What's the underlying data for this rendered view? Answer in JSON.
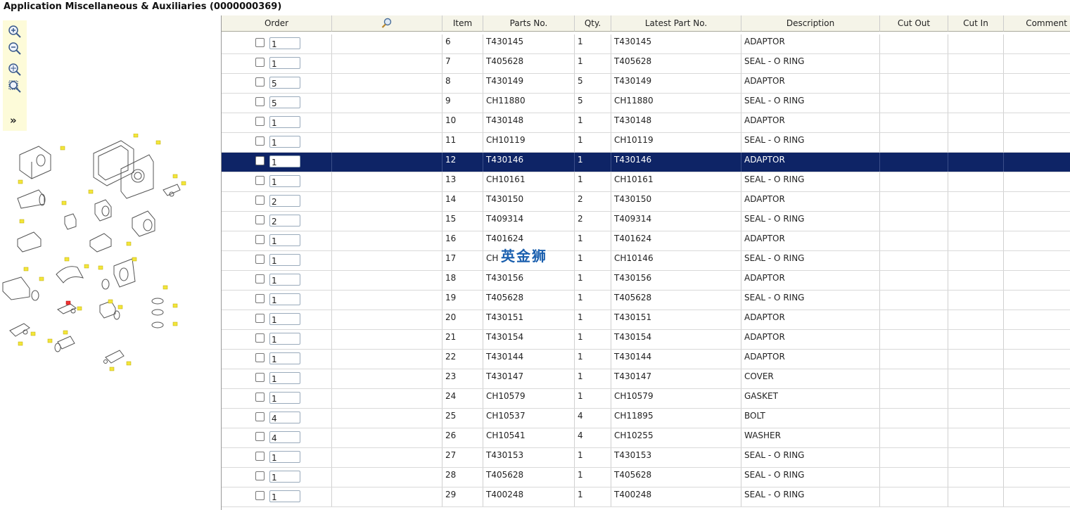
{
  "title": "Application Miscellaneous & Auxiliaries (0000000369)",
  "zoom_tools": [
    "zoom-in-icon",
    "zoom-out-icon",
    "zoom-fit-icon",
    "zoom-area-icon"
  ],
  "expand_label": "»",
  "watermark": "英金狮",
  "columns": {
    "order": "Order",
    "search_icon": "search-icon",
    "item": "Item",
    "parts_no": "Parts No.",
    "qty": "Qty.",
    "latest": "Latest Part No.",
    "description": "Description",
    "cut_out": "Cut Out",
    "cut_in": "Cut In",
    "comment": "Comment"
  },
  "colors": {
    "selected_row": "#0e2466",
    "header_bg": "#f5f4e8",
    "gear": "#3e9b3a",
    "info": "#5f7da8",
    "supersede": "#e23b3b"
  },
  "selected_item": "12",
  "rows": [
    {
      "order": "1",
      "item": "6",
      "part": "T430145",
      "qty": "1",
      "latest": "T430145",
      "desc": "ADAPTOR"
    },
    {
      "order": "1",
      "item": "7",
      "part": "T405628",
      "qty": "1",
      "latest": "T405628",
      "desc": "SEAL - O RING"
    },
    {
      "order": "5",
      "item": "8",
      "part": "T430149",
      "qty": "5",
      "latest": "T430149",
      "desc": "ADAPTOR"
    },
    {
      "order": "5",
      "item": "9",
      "part": "CH11880",
      "qty": "5",
      "latest": "CH11880",
      "desc": "SEAL - O RING"
    },
    {
      "order": "1",
      "item": "10",
      "part": "T430148",
      "qty": "1",
      "latest": "T430148",
      "desc": "ADAPTOR"
    },
    {
      "order": "1",
      "item": "11",
      "part": "CH10119",
      "qty": "1",
      "latest": "CH10119",
      "desc": "SEAL - O RING"
    },
    {
      "order": "1",
      "item": "12",
      "part": "T430146",
      "qty": "1",
      "latest": "T430146",
      "desc": "ADAPTOR"
    },
    {
      "order": "1",
      "item": "13",
      "part": "CH10161",
      "qty": "1",
      "latest": "CH10161",
      "desc": "SEAL - O RING",
      "flag": "S"
    },
    {
      "order": "2",
      "item": "14",
      "part": "T430150",
      "qty": "2",
      "latest": "T430150",
      "desc": "ADAPTOR"
    },
    {
      "order": "2",
      "item": "15",
      "part": "T409314",
      "qty": "2",
      "latest": "T409314",
      "desc": "SEAL - O RING"
    },
    {
      "order": "1",
      "item": "16",
      "part": "T401624",
      "qty": "1",
      "latest": "T401624",
      "desc": "ADAPTOR"
    },
    {
      "order": "1",
      "item": "17",
      "part": "CH",
      "qty": "1",
      "latest": "CH10146",
      "desc": "SEAL - O RING"
    },
    {
      "order": "1",
      "item": "18",
      "part": "T430156",
      "qty": "1",
      "latest": "T430156",
      "desc": "ADAPTOR"
    },
    {
      "order": "1",
      "item": "19",
      "part": "T405628",
      "qty": "1",
      "latest": "T405628",
      "desc": "SEAL - O RING"
    },
    {
      "order": "1",
      "item": "20",
      "part": "T430151",
      "qty": "1",
      "latest": "T430151",
      "desc": "ADAPTOR"
    },
    {
      "order": "1",
      "item": "21",
      "part": "T430154",
      "qty": "1",
      "latest": "T430154",
      "desc": "ADAPTOR"
    },
    {
      "order": "1",
      "item": "22",
      "part": "T430144",
      "qty": "1",
      "latest": "T430144",
      "desc": "ADAPTOR"
    },
    {
      "order": "1",
      "item": "23",
      "part": "T430147",
      "qty": "1",
      "latest": "T430147",
      "desc": "COVER"
    },
    {
      "order": "1",
      "item": "24",
      "part": "CH10579",
      "qty": "1",
      "latest": "CH10579",
      "desc": "GASKET"
    },
    {
      "order": "4",
      "item": "25",
      "part": "CH10537",
      "qty": "4",
      "latest": "CH11895",
      "desc": "BOLT"
    },
    {
      "order": "4",
      "item": "26",
      "part": "CH10541",
      "qty": "4",
      "latest": "CH10255",
      "desc": "WASHER"
    },
    {
      "order": "1",
      "item": "27",
      "part": "T430153",
      "qty": "1",
      "latest": "T430153",
      "desc": "SEAL - O RING"
    },
    {
      "order": "1",
      "item": "28",
      "part": "T405628",
      "qty": "1",
      "latest": "T405628",
      "desc": "SEAL - O RING"
    },
    {
      "order": "1",
      "item": "29",
      "part": "T400248",
      "qty": "1",
      "latest": "T400248",
      "desc": "SEAL - O RING"
    }
  ]
}
